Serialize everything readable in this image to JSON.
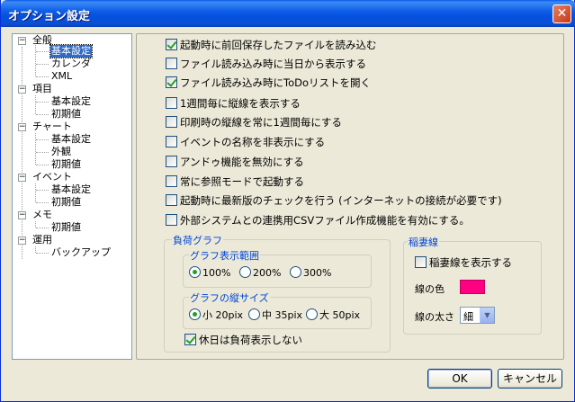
{
  "window": {
    "title": "オプション設定",
    "close": "✕"
  },
  "tree": {
    "nodes": [
      {
        "label": "全般",
        "level": 0,
        "expander": "−"
      },
      {
        "label": "基本設定",
        "level": 1,
        "selected": true
      },
      {
        "label": "カレンダ",
        "level": 1
      },
      {
        "label": "XML",
        "level": 1
      },
      {
        "label": "項目",
        "level": 0,
        "expander": "−"
      },
      {
        "label": "基本設定",
        "level": 1
      },
      {
        "label": "初期値",
        "level": 1
      },
      {
        "label": "チャート",
        "level": 0,
        "expander": "−"
      },
      {
        "label": "基本設定",
        "level": 1
      },
      {
        "label": "外観",
        "level": 1
      },
      {
        "label": "初期値",
        "level": 1
      },
      {
        "label": "イベント",
        "level": 0,
        "expander": "−"
      },
      {
        "label": "基本設定",
        "level": 1
      },
      {
        "label": "初期値",
        "level": 1
      },
      {
        "label": "メモ",
        "level": 0,
        "expander": "−"
      },
      {
        "label": "初期値",
        "level": 1
      },
      {
        "label": "運用",
        "level": 0,
        "expander": "−"
      },
      {
        "label": "バックアップ",
        "level": 1
      }
    ]
  },
  "options": [
    {
      "label": "起動時に前回保存したファイルを読み込む",
      "checked": true
    },
    {
      "label": "ファイル読み込み時に当日から表示する",
      "checked": false
    },
    {
      "label": "ファイル読み込み時にToDoリストを開く",
      "checked": true
    },
    {
      "label": "1週間毎に縦線を表示する",
      "checked": false
    },
    {
      "label": "印刷時の縦線を常に1週間毎にする",
      "checked": false
    },
    {
      "label": "イベントの名称を非表示にする",
      "checked": false
    },
    {
      "label": "アンドゥ機能を無効にする",
      "checked": false
    },
    {
      "label": "常に参照モードで起動する",
      "checked": false
    },
    {
      "label": "起動時に最新版のチェックを行う (インターネットの接続が必要です)",
      "checked": false
    },
    {
      "label": "外部システムとの連携用CSVファイル作成機能を有効にする。",
      "checked": false
    }
  ],
  "load_graph": {
    "title": "負荷グラフ",
    "range": {
      "title": "グラフ表示範囲",
      "options": [
        "100%",
        "200%",
        "300%"
      ],
      "selected": 0
    },
    "size": {
      "title": "グラフの縦サイズ",
      "options": [
        "小 20pix",
        "中 35pix",
        "大 50pix"
      ],
      "selected": 0
    },
    "holiday": {
      "label": "休日は負荷表示しない",
      "checked": true
    }
  },
  "lightning": {
    "title": "稲妻線",
    "show": {
      "label": "稲妻線を表示する",
      "checked": false
    },
    "color_label": "線の色",
    "color": "#ff0080",
    "width_label": "線の太さ",
    "width_value": "細",
    "dropdown_arrow": "▼"
  },
  "buttons": {
    "ok": "OK",
    "cancel": "キャンセル"
  }
}
